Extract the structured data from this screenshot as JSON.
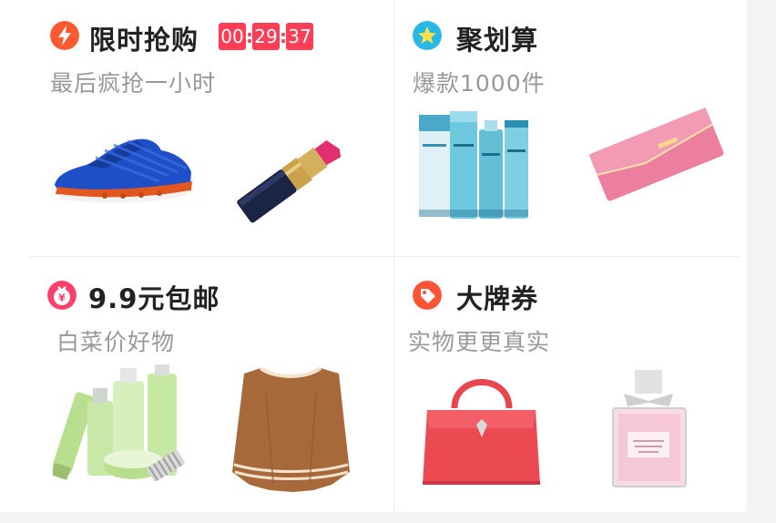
{
  "flash_sale": {
    "title": "限时抢购",
    "subtitle": "最后疯抢一小时",
    "timer": {
      "hours": "00",
      "minutes": "29",
      "seconds": "37"
    },
    "icon": "lightning-icon",
    "products": [
      "sneaker-image",
      "lipstick-image"
    ]
  },
  "juhuasuan": {
    "title": "聚划算",
    "subtitle": "爆款1000件",
    "icon": "star-icon",
    "products": [
      "skincare-set-image",
      "wallet-image"
    ]
  },
  "nine_nine": {
    "title": "9.9元包邮",
    "subtitle": "白菜价好物",
    "icon": "money-bag-icon",
    "products": [
      "green-skincare-image",
      "knit-poncho-image"
    ]
  },
  "big_brand": {
    "title": "大牌券",
    "subtitle": "实物更更真实",
    "icon": "tag-icon",
    "products": [
      "handbag-image",
      "perfume-image"
    ]
  },
  "colors": {
    "accent": "#ff3d55",
    "title": "#222222",
    "subtitle": "#999999"
  }
}
